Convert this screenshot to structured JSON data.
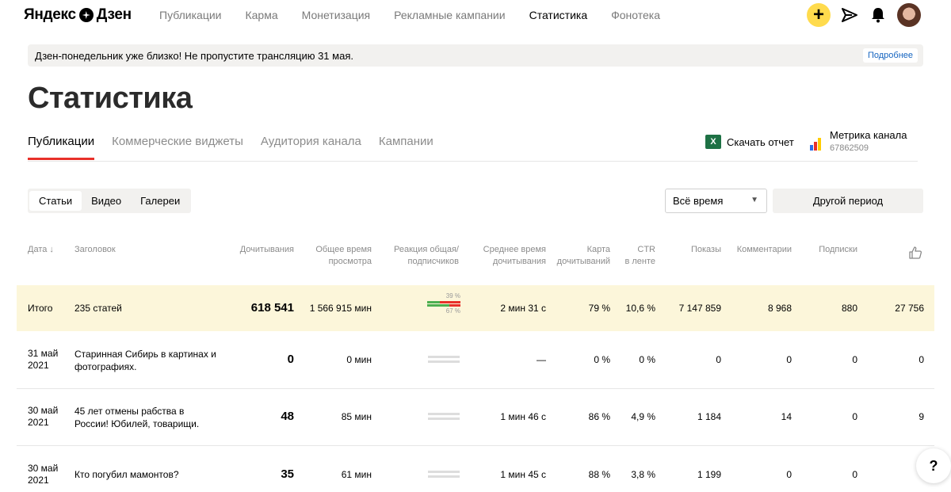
{
  "header": {
    "logo_text_1": "Яндекс",
    "logo_text_2": "Дзен",
    "nav": [
      "Публикации",
      "Карма",
      "Монетизация",
      "Рекламные кампании",
      "Статистика",
      "Фонотека"
    ],
    "active_nav": "Статистика",
    "plus_label": "+"
  },
  "banner": {
    "text": "Дзен-понедельник уже близко! Не пропустите трансляцию 31 мая.",
    "link": "Подробнее"
  },
  "page_title": "Статистика",
  "tabs": [
    "Публикации",
    "Коммерческие виджеты",
    "Аудитория канала",
    "Кампании"
  ],
  "report": {
    "label": "Скачать отчет",
    "icon_letter": "X"
  },
  "metrika": {
    "title": "Метрика канала",
    "id": "67862509"
  },
  "content_types": [
    "Статьи",
    "Видео",
    "Галереи"
  ],
  "period": {
    "selected": "Всё время",
    "other": "Другой период"
  },
  "columns": {
    "date": "Дата ↓",
    "title": "Заголовок",
    "reads": "Дочитывания",
    "time1": "Общее время",
    "time2": "просмотра",
    "react1": "Реакция общая/",
    "react2": "подписчиков",
    "avg1": "Среднее время",
    "avg2": "дочитывания",
    "map1": "Карта",
    "map2": "дочитываний",
    "ctr1": "CTR",
    "ctr2": "в ленте",
    "shows": "Показы",
    "comments": "Комментарии",
    "subs": "Подписки"
  },
  "total": {
    "label": "Итого",
    "title": "235 статей",
    "reads": "618 541",
    "time": "1 566 915 мин",
    "react_top": "39 %",
    "react_bottom": "67 %",
    "avg": "2 мин 31 с",
    "map": "79 %",
    "ctr": "10,6 %",
    "shows": "7 147 859",
    "comments": "8 968",
    "subs": "880",
    "likes": "27 756"
  },
  "rows": [
    {
      "date1": "31 май",
      "date2": "2021",
      "title": "Старинная Сибирь в картинах и фотографиях.",
      "reads": "0",
      "time": "0 мин",
      "avg": "—",
      "map": "0 %",
      "ctr": "0 %",
      "shows": "0",
      "comments": "0",
      "subs": "0",
      "likes": "0"
    },
    {
      "date1": "30 май",
      "date2": "2021",
      "title": "45 лет отмены рабства в России! Юбилей, товарищи.",
      "reads": "48",
      "time": "85 мин",
      "avg": "1 мин 46 с",
      "map": "86 %",
      "ctr": "4,9 %",
      "shows": "1 184",
      "comments": "14",
      "subs": "0",
      "likes": "9"
    },
    {
      "date1": "30 май",
      "date2": "2021",
      "title": "Кто погубил мамонтов?",
      "reads": "35",
      "time": "61 мин",
      "avg": "1 мин 45 с",
      "map": "88 %",
      "ctr": "3,8 %",
      "shows": "1 199",
      "comments": "0",
      "subs": "0",
      "likes": ""
    }
  ],
  "help_label": "?",
  "colors": {
    "accent_yellow": "#ffdb4d",
    "tab_red": "#e8302a",
    "total_bg": "#fcf6da",
    "link_blue": "#1564c0"
  }
}
